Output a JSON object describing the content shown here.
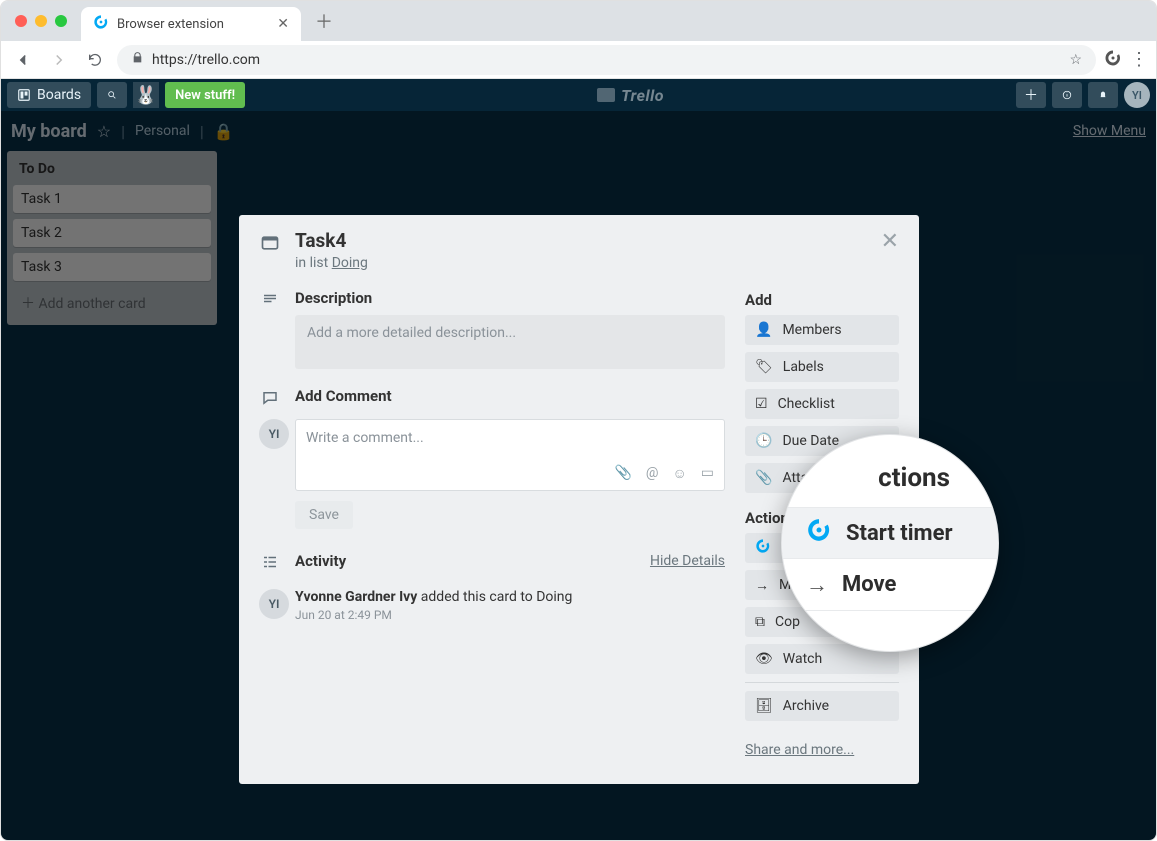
{
  "browser": {
    "tab_title": "Browser extension",
    "url": "https://trello.com"
  },
  "trello_header": {
    "boards": "Boards",
    "new_stuff": "New stuff!",
    "logo_text": "Trello",
    "avatar_initials": "YI"
  },
  "board_bar": {
    "name": "My board",
    "scope": "Personal",
    "show_menu": "Show Menu"
  },
  "list": {
    "title": "To Do",
    "cards": [
      "Task 1",
      "Task 2",
      "Task 3"
    ],
    "add_card": "Add another card"
  },
  "modal": {
    "title": "Task4",
    "sub_prefix": "in list ",
    "sub_list": "Doing",
    "description_label": "Description",
    "description_placeholder": "Add a more detailed description...",
    "comment_label": "Add Comment",
    "comment_placeholder": "Write a comment...",
    "save": "Save",
    "activity_label": "Activity",
    "hide_details": "Hide Details",
    "activity_user": "Yvonne Gardner Ivy",
    "activity_action": " added this card to Doing",
    "activity_time": "Jun 20 at 2:49 PM",
    "commenter_initials": "YI"
  },
  "sidebar": {
    "add_label": "Add",
    "members": "Members",
    "labels": "Labels",
    "checklist": "Checklist",
    "due_date": "Due Date",
    "attachment": "Atta",
    "actions_label": "Actions",
    "start_timer": "Start timer",
    "move": "Move",
    "copy": "Cop",
    "watch": "Watch",
    "archive": "Archive",
    "share": "Share and more..."
  },
  "zoom": {
    "head": "ctions",
    "start_timer": "Start timer",
    "move": "Move"
  }
}
